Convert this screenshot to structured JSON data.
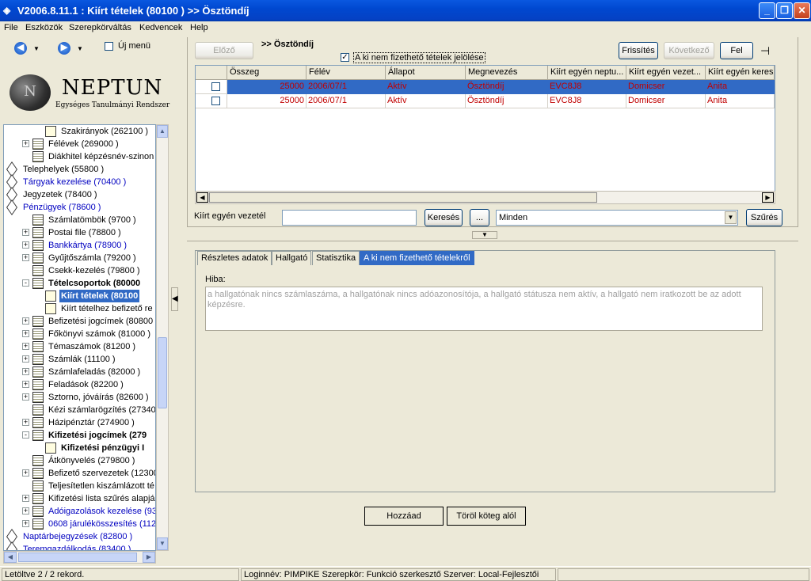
{
  "window": {
    "title": "V2006.8.11.1 : Kiírt tételek (80100  )  >> Ösztöndíj",
    "minimize": "_",
    "maximize": "❐",
    "close": "✕"
  },
  "menu": [
    "File",
    "Eszközök",
    "Szerepkörváltás",
    "Kedvencek",
    "Help"
  ],
  "left": {
    "back_icon": "◀",
    "forward_icon": "▶",
    "new_menu_label": "Új menü",
    "logo_title": "NEPTUN",
    "logo_subtitle": "Egységes Tanulmányi Rendszer",
    "tree": [
      {
        "label": "Szakirányok (262100  )",
        "depth": 3,
        "icon": "doc",
        "exp": "",
        "style": ""
      },
      {
        "label": "Félévek (269000  )",
        "depth": 2,
        "icon": "book",
        "exp": "+",
        "style": ""
      },
      {
        "label": "Diákhitel képzésnév-szinon",
        "depth": 2,
        "icon": "book",
        "exp": "",
        "style": ""
      },
      {
        "label": "Telephelyek (55800  )",
        "depth": 0,
        "icon": "dia",
        "exp": "+",
        "style": ""
      },
      {
        "label": "Tárgyak kezelése (70400  )",
        "depth": 0,
        "icon": "dia",
        "exp": "+",
        "style": "blue"
      },
      {
        "label": "Jegyzetek (78400  )",
        "depth": 0,
        "icon": "dia",
        "exp": "",
        "style": ""
      },
      {
        "label": "Pénzügyek (78600  )",
        "depth": 0,
        "icon": "dia",
        "exp": "-",
        "style": "blue"
      },
      {
        "label": "Számlatömbök (9700  )",
        "depth": 2,
        "icon": "book",
        "exp": "",
        "style": ""
      },
      {
        "label": "Postai file (78800  )",
        "depth": 2,
        "icon": "book",
        "exp": "+",
        "style": ""
      },
      {
        "label": "Bankkártya (78900  )",
        "depth": 2,
        "icon": "book",
        "exp": "+",
        "style": "blue"
      },
      {
        "label": "Gyűjtőszámla (79200  )",
        "depth": 2,
        "icon": "book",
        "exp": "+",
        "style": ""
      },
      {
        "label": "Csekk-kezelés (79800  )",
        "depth": 2,
        "icon": "book",
        "exp": "",
        "style": ""
      },
      {
        "label": "Tételcsoportok (80000  ",
        "depth": 2,
        "icon": "book",
        "exp": "-",
        "style": "bold"
      },
      {
        "label": "Kiírt tételek (80100  ",
        "depth": 3,
        "icon": "doc",
        "exp": "",
        "style": "selected"
      },
      {
        "label": "Kiírt tételhez befizető re",
        "depth": 3,
        "icon": "doc",
        "exp": "",
        "style": ""
      },
      {
        "label": "Befizetési jogcímek (80800",
        "depth": 2,
        "icon": "book",
        "exp": "+",
        "style": ""
      },
      {
        "label": "Főkönyvi számok (81000  )",
        "depth": 2,
        "icon": "book",
        "exp": "+",
        "style": ""
      },
      {
        "label": "Témaszámok (81200  )",
        "depth": 2,
        "icon": "book",
        "exp": "+",
        "style": ""
      },
      {
        "label": "Számlák (11100  )",
        "depth": 2,
        "icon": "book",
        "exp": "+",
        "style": ""
      },
      {
        "label": "Számlafeladás (82000  )",
        "depth": 2,
        "icon": "book",
        "exp": "+",
        "style": ""
      },
      {
        "label": "Feladások (82200  )",
        "depth": 2,
        "icon": "book",
        "exp": "+",
        "style": ""
      },
      {
        "label": "Sztorno, jóváírás (82600  )",
        "depth": 2,
        "icon": "book",
        "exp": "+",
        "style": ""
      },
      {
        "label": "Kézi számlarögzítés (27340(",
        "depth": 2,
        "icon": "book",
        "exp": "",
        "style": ""
      },
      {
        "label": "Házipénztár (274900  )",
        "depth": 2,
        "icon": "book",
        "exp": "+",
        "style": ""
      },
      {
        "label": "Kifizetési jogcímek (279",
        "depth": 2,
        "icon": "book",
        "exp": "-",
        "style": "bold"
      },
      {
        "label": "Kifizetési pénzügyi I",
        "depth": 3,
        "icon": "doc",
        "exp": "",
        "style": "bold"
      },
      {
        "label": "Átkönyvelés (279800  )",
        "depth": 2,
        "icon": "book",
        "exp": "",
        "style": ""
      },
      {
        "label": "Befizető szervezetek (12300(",
        "depth": 2,
        "icon": "book",
        "exp": "+",
        "style": ""
      },
      {
        "label": "Teljesítetlen kiszámlázott té",
        "depth": 2,
        "icon": "book",
        "exp": "",
        "style": ""
      },
      {
        "label": "Kifizetési lista szűrés alapján",
        "depth": 2,
        "icon": "book",
        "exp": "+",
        "style": ""
      },
      {
        "label": "Adóigazolások kezelése (93",
        "depth": 2,
        "icon": "book",
        "exp": "+",
        "style": "blue"
      },
      {
        "label": "0608 járulékösszesítés (112",
        "depth": 2,
        "icon": "book",
        "exp": "+",
        "style": "blue"
      },
      {
        "label": "Naptárbejegyzések (82800  )",
        "depth": 0,
        "icon": "dia",
        "exp": "+",
        "style": "blue"
      },
      {
        "label": "Teremgazdálkodás (83400  )",
        "depth": 0,
        "icon": "dia",
        "exp": "+",
        "style": "blue"
      }
    ]
  },
  "toolbar": {
    "prev": "Előző",
    "title": ">> Ösztöndíj",
    "refresh": "Frissítés",
    "next": "Következő",
    "up": "Fel",
    "pin_icon": "⊣",
    "checkbox_label": "A ki nem fizethető tételek jelölése",
    "checkbox_checked": "✓"
  },
  "grid": {
    "columns": [
      "Összeg",
      "Félév",
      "Állapot",
      "Megnevezés",
      "Kiírt egyén neptu...",
      "Kiírt egyén vezet...",
      "Kiírt egyén keresz"
    ],
    "rows": [
      [
        "25000",
        "2006/07/1",
        "Aktív",
        "Ösztöndíj",
        "EVC8J8",
        "Domicser",
        "Anita"
      ],
      [
        "25000",
        "2006/07/1",
        "Aktív",
        "Ösztöndíj",
        "EVC8J8",
        "Domicser",
        "Anita"
      ]
    ]
  },
  "filter": {
    "label": "Kiírt egyén vezetél",
    "input_value": "",
    "search": "Keresés",
    "dots": "...",
    "select_value": "Minden",
    "filter_btn": "Szűrés"
  },
  "tabs": {
    "items": [
      "Részletes adatok",
      "Hallgató",
      "Statisztika",
      "A ki nem fizethető tételekről"
    ],
    "active": 3,
    "error_label": "Hiba:",
    "error_text": "a hallgatónak nincs számlaszáma, a hallgatónak nincs adóazonosítója, a hallgató státusza nem aktív, a hallgató nem iratkozott be az adott képzésre."
  },
  "actions": {
    "add": "Hozzáad",
    "remove": "Töröl köteg alól"
  },
  "status": {
    "records": "Letöltve 2 / 2 rekord.",
    "info": "Loginnév: PIMPIKE   Szerepkör: Funkció szerkesztő   Szerver: Local-Fejlesztői"
  }
}
